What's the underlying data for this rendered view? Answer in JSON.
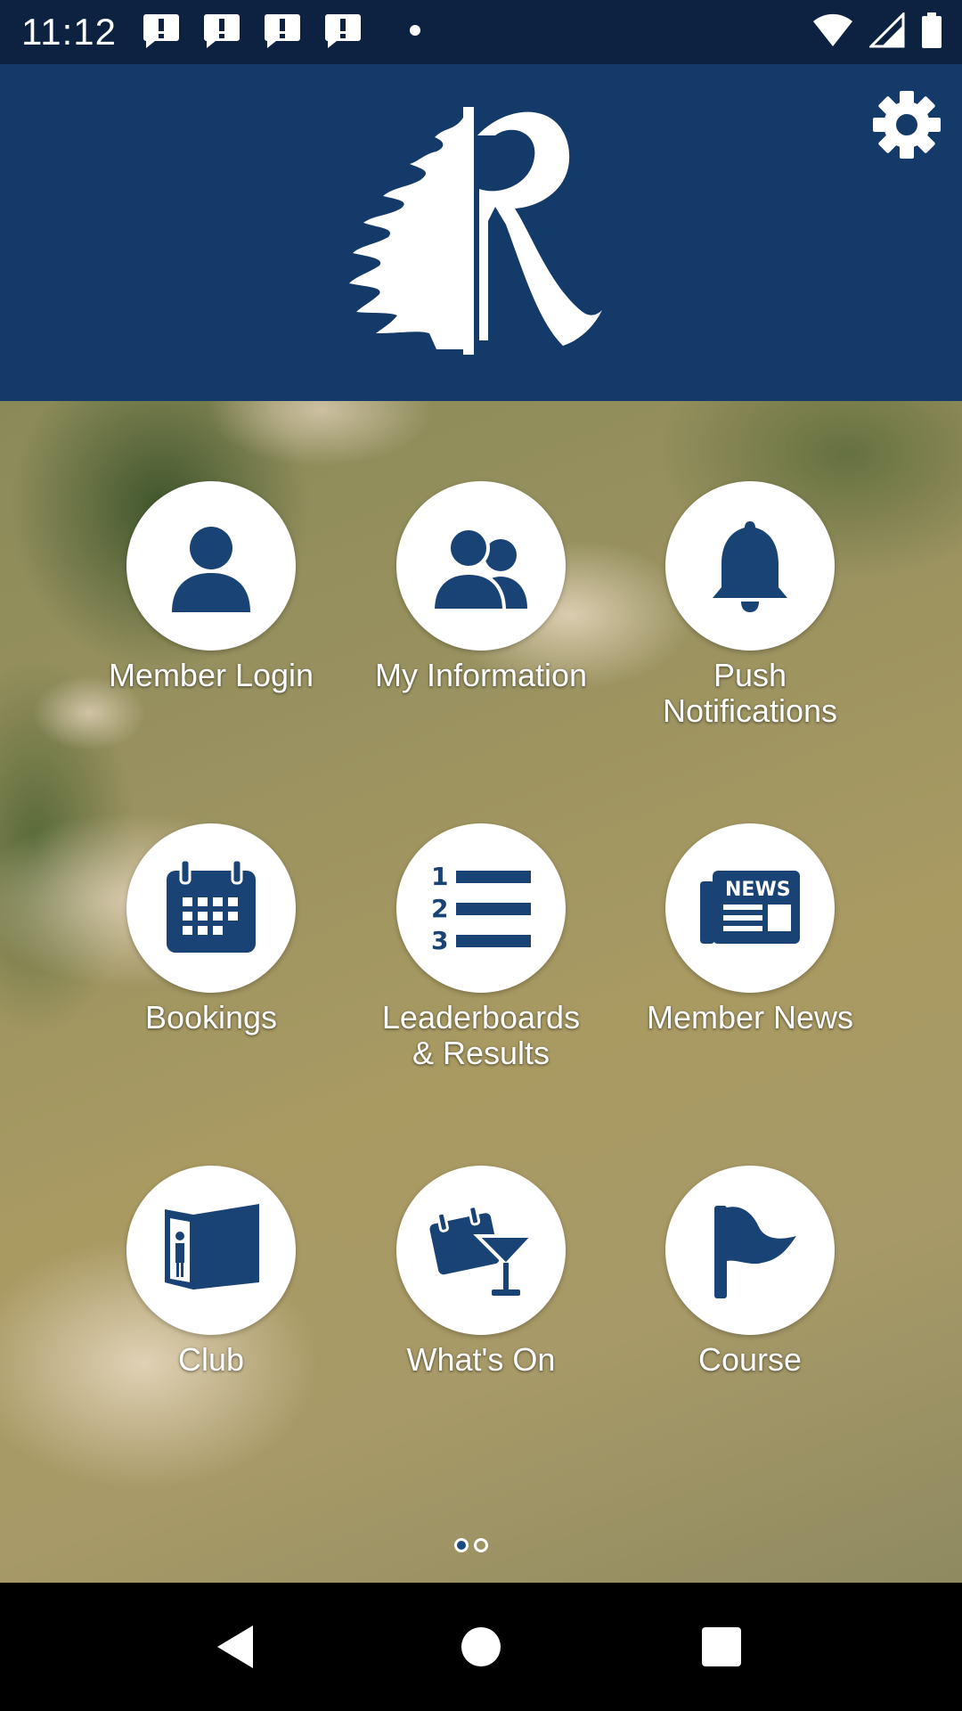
{
  "status_bar": {
    "time": "11:12",
    "notification_icons": [
      "alert-icon",
      "alert-icon",
      "alert-icon",
      "alert-icon"
    ],
    "system_icons": [
      "wifi-icon",
      "signal-icon",
      "battery-icon"
    ]
  },
  "header": {
    "logo": "R",
    "settings_icon": "gear-icon"
  },
  "colors": {
    "brand_navy": "#143a6a",
    "icon_navy": "#1a4375",
    "status_bar": "#0d2240",
    "pager_active": "#1a4a82"
  },
  "menu": [
    {
      "label": "Member Login",
      "icon": "person-icon"
    },
    {
      "label": "My Information",
      "icon": "people-icon"
    },
    {
      "label": "Push Notifications",
      "icon": "bell-icon"
    },
    {
      "label": "Bookings",
      "icon": "calendar-icon"
    },
    {
      "label": "Leaderboards & Results",
      "icon": "numbered-list-icon"
    },
    {
      "label": "Member News",
      "icon": "newspaper-icon",
      "icon_text": "NEWS"
    },
    {
      "label": "Club",
      "icon": "map-person-icon"
    },
    {
      "label": "What's On",
      "icon": "calendar-cocktail-icon"
    },
    {
      "label": "Course",
      "icon": "flag-icon"
    }
  ],
  "pager": {
    "pages": 2,
    "current": 1
  },
  "nav_bar": [
    "back-icon",
    "home-icon",
    "recents-icon"
  ]
}
